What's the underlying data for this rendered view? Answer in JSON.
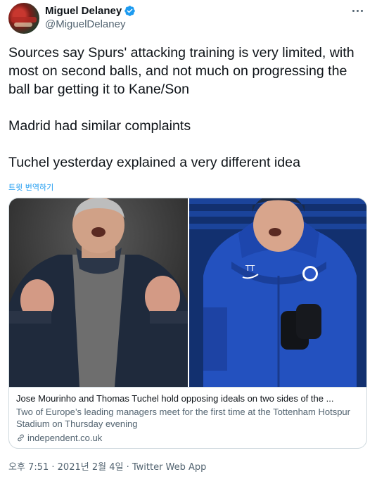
{
  "author": {
    "display_name": "Miguel Delaney",
    "handle": "@MiguelDelaney",
    "verified": true,
    "avatar_icon": "avatar-photo"
  },
  "tweet": {
    "paragraphs": [
      "Sources say Spurs' attacking training is very limited, with most on second balls, and not much on progressing the ball bar getting it to Kane/Son",
      "Madrid had similar complaints",
      "Tuchel yesterday explained a very different idea"
    ],
    "translate_label": "트윗 번역하기"
  },
  "card": {
    "title": "Jose Mourinho and Thomas Tuchel hold opposing ideals on two sides of the ...",
    "description": "Two of Europe’s leading managers meet for the first time at the Tottenham Hotspur Stadium on Thursday evening",
    "domain": "independent.co.uk",
    "images": [
      "photo-mourinho",
      "photo-tuchel"
    ]
  },
  "meta": {
    "time": "오후 7:51",
    "date": "2021년 2월 4일",
    "separator": " · ",
    "source": "Twitter Web App"
  },
  "colors": {
    "link": "#1d9bf0",
    "secondary_text": "#536471",
    "border": "#cfd9de",
    "verified": "#1d9bf0"
  }
}
